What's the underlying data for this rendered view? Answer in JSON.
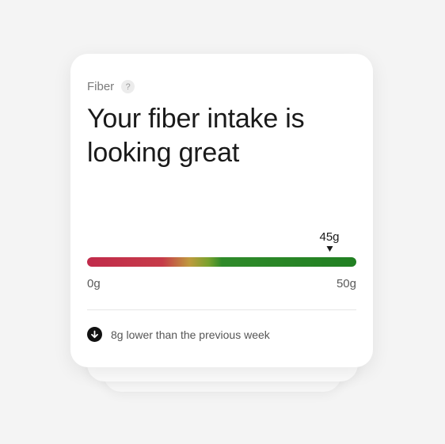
{
  "card": {
    "category": "Fiber",
    "help_glyph": "?",
    "headline": "Your fiber intake is looking great"
  },
  "gauge": {
    "min_label": "0g",
    "max_label": "50g",
    "min_value": 0,
    "max_value": 50,
    "current_value": 45,
    "current_label": "45g"
  },
  "comparison": {
    "icon": "arrow-down-circle-icon",
    "text": "8g lower than the previous week"
  },
  "colors": {
    "low": "#c12b4b",
    "mid": "#bf9a3e",
    "high": "#218022"
  }
}
